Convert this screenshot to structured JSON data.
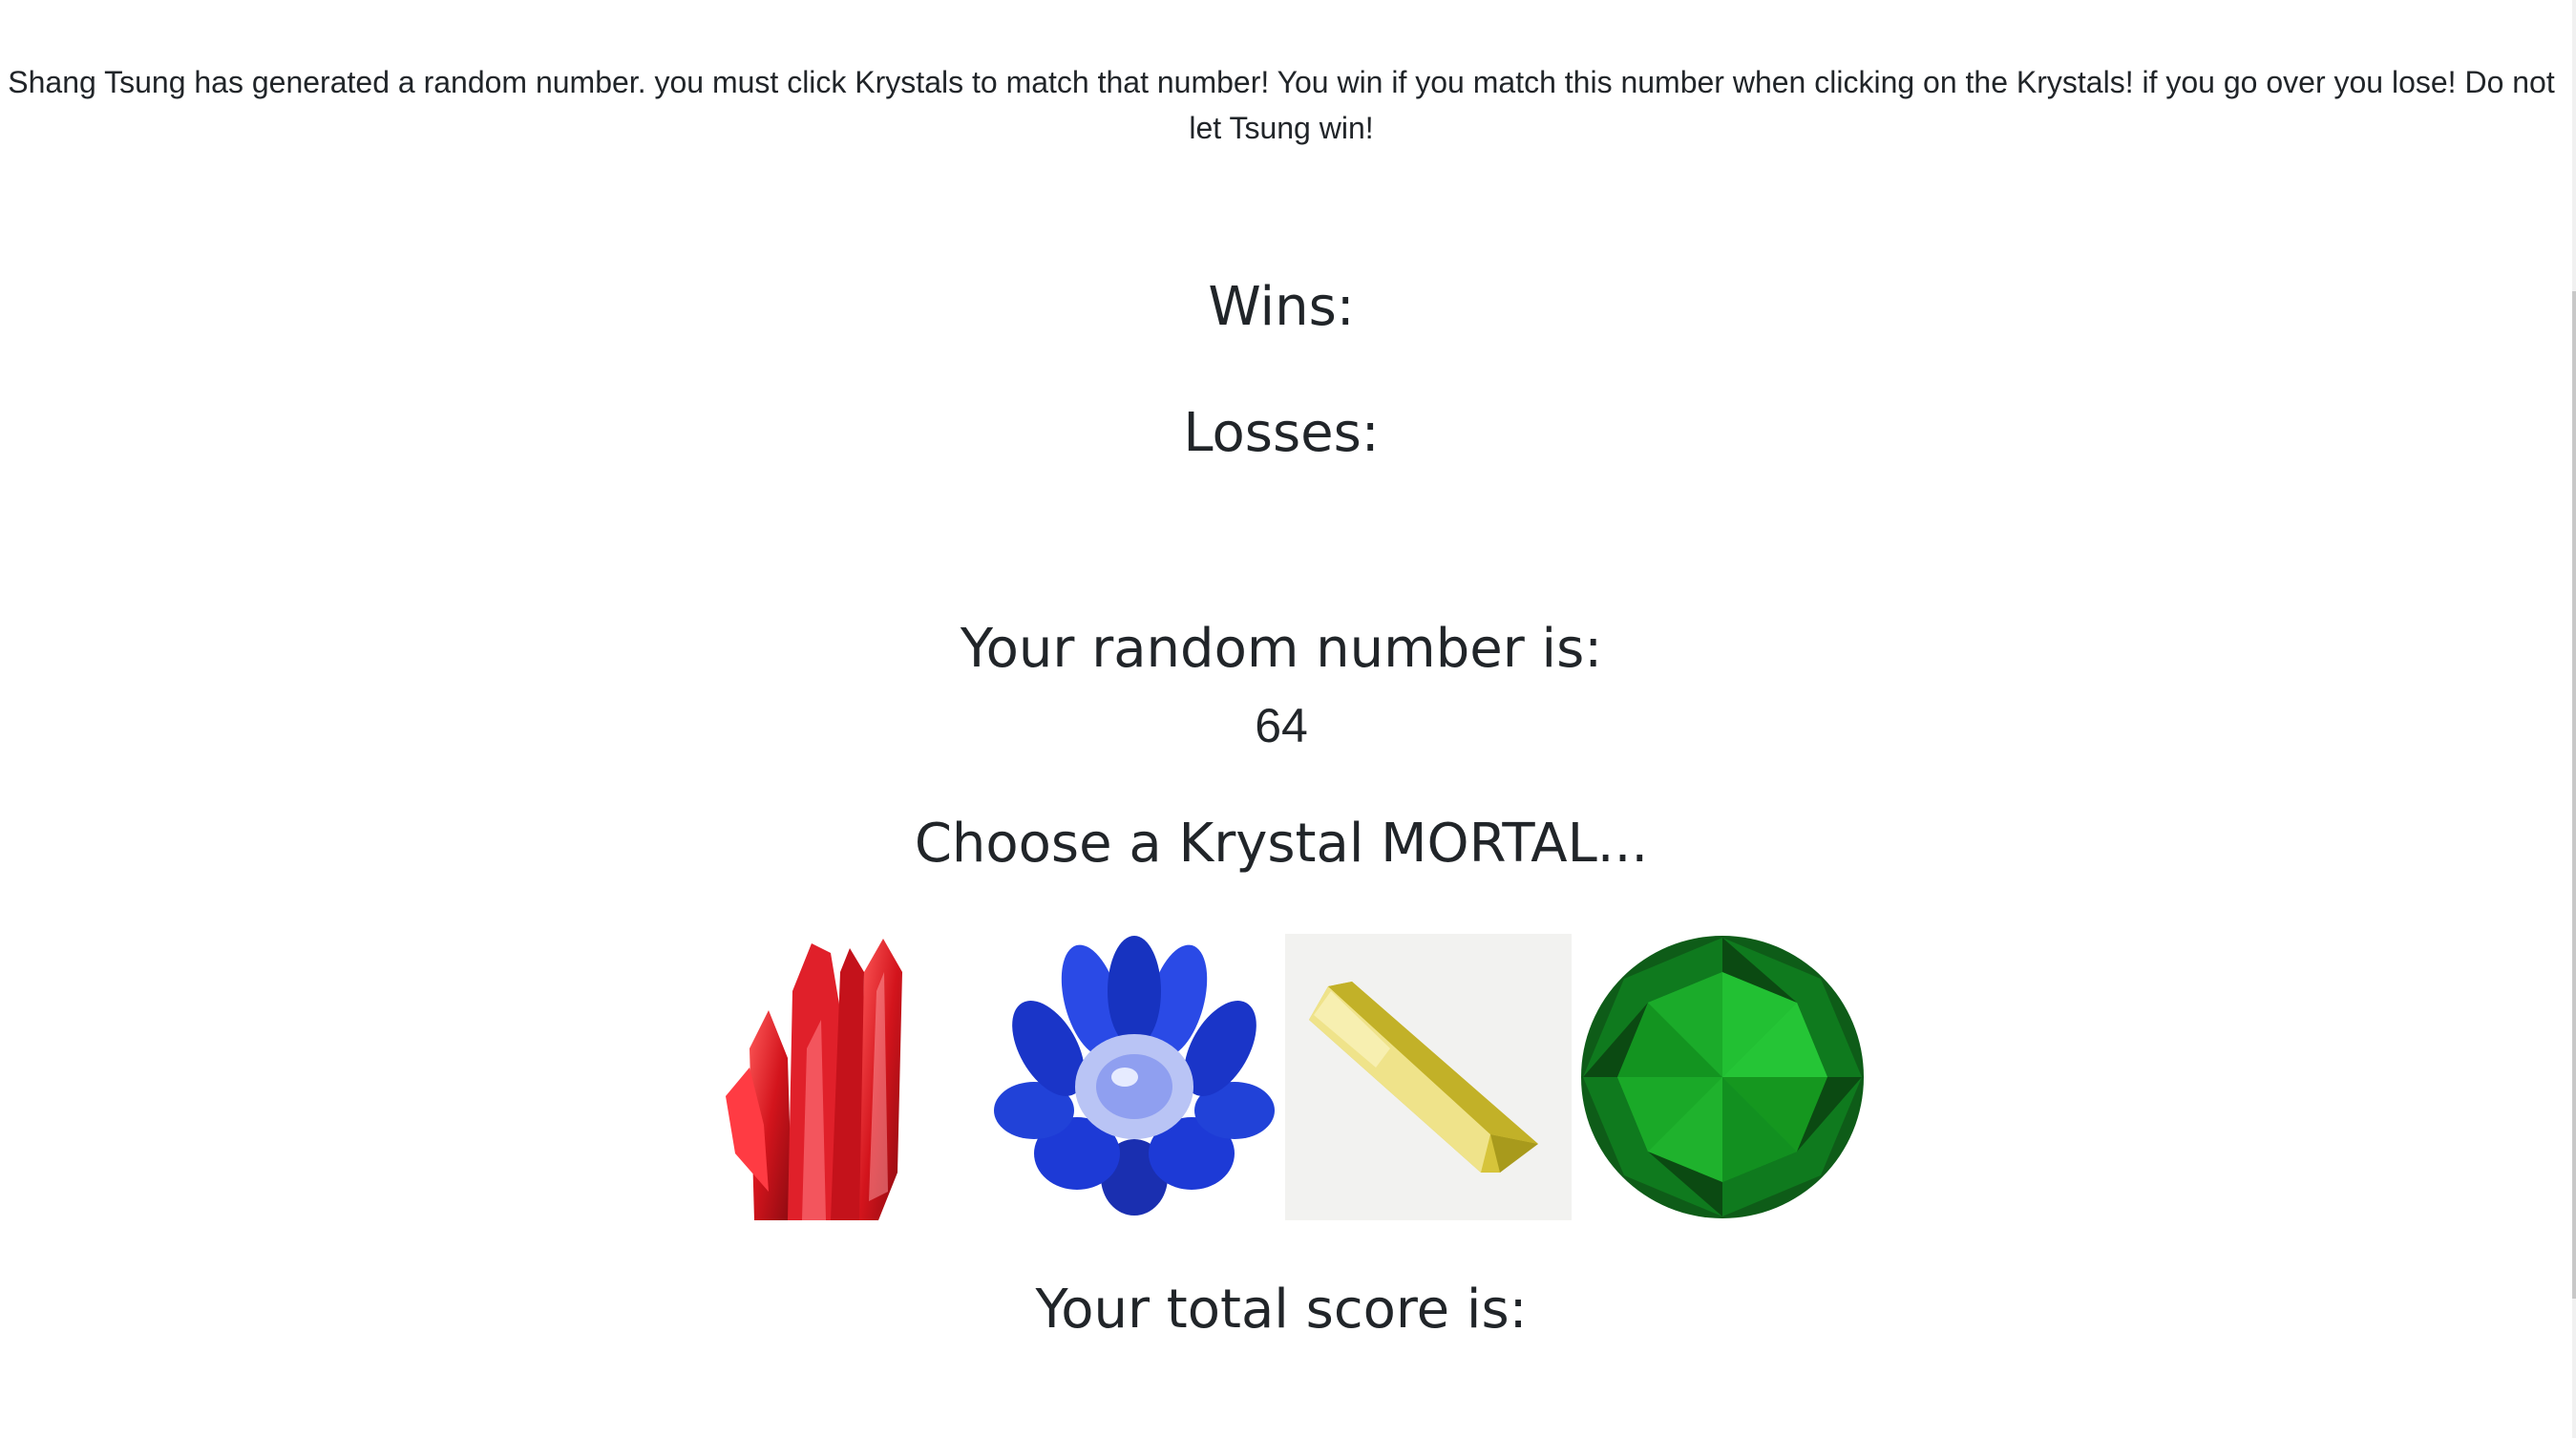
{
  "instructions": "Shang Tsung has generated a random number. you must click Krystals to match that number! You win if you match this number when clicking on the Krystals! if you go over you lose! Do not let Tsung win!",
  "wins_label": "Wins:",
  "losses_label": "Losses:",
  "random_number_label": "Your random number is:",
  "random_number_value": "64",
  "choose_label": "Choose a Krystal MORTAL...",
  "krystals": [
    {
      "name": "red",
      "icon": "red-crystal-cluster-icon",
      "color": "#d3141c"
    },
    {
      "name": "blue",
      "icon": "blue-lotus-crystal-icon",
      "color": "#1432c8"
    },
    {
      "name": "yellow",
      "icon": "yellow-crystal-point-icon",
      "color": "#d8c830"
    },
    {
      "name": "green",
      "icon": "green-diamond-gem-icon",
      "color": "#17a626"
    }
  ],
  "total_score_label": "Your total score is:"
}
